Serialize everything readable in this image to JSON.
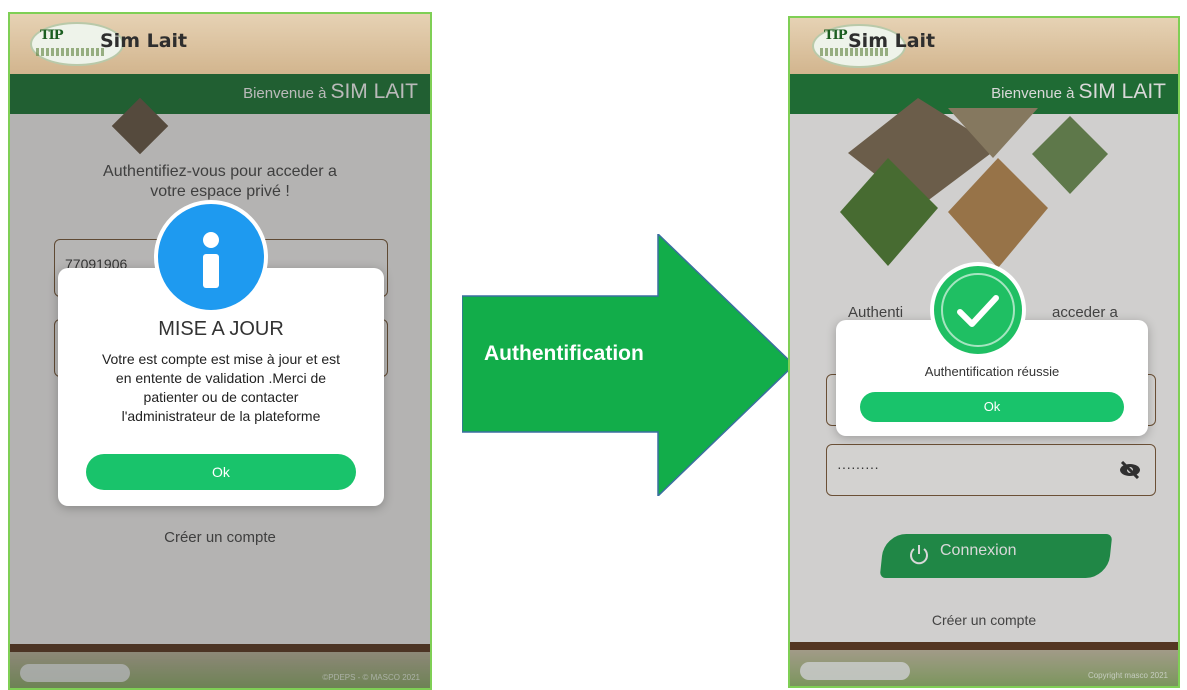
{
  "left_screen": {
    "app_name": "Sim Lait",
    "logo_text": "TIP",
    "welcome_prefix": "Bienvenue à",
    "welcome_brand": "SIM LAIT",
    "auth_prompt_line1": "Authentifiez-vous pour acceder a",
    "auth_prompt_line2": "votre espace privé !",
    "phone_field_value": "77091906",
    "dialog": {
      "title": "MISE A JOUR",
      "message_lines": [
        "Votre est compte est mise à jour et est",
        "en entente de validation .Merci de",
        "patienter ou de contacter",
        "l'administrateur de la plateforme"
      ],
      "ok_label": "Ok"
    },
    "create_account": "Créer un compte",
    "footer_copy": "©PDEPS - © MASCO 2021"
  },
  "arrow": {
    "label": "Authentification",
    "color": "#12ad4a"
  },
  "right_screen": {
    "app_name": "Sim Lait",
    "logo_text": "TIP",
    "welcome_prefix": "Bienvenue à",
    "welcome_brand": "SIM LAIT",
    "auth_prompt_partial_left": "Authenti",
    "auth_prompt_partial_right": "acceder a",
    "password_value": "·········",
    "dialog": {
      "message": "Authentification réussie",
      "ok_label": "Ok"
    },
    "connexion_label": "Connexion",
    "create_account": "Créer un compte",
    "footer_copy": "Copyright masco 2021"
  },
  "colors": {
    "header_green": "#1e7a37",
    "button_green": "#19c36b",
    "info_blue": "#1e9af0",
    "success_green": "#1fbf63"
  },
  "icons": {
    "info": "info-icon",
    "success": "checkmark-icon",
    "eye": "eye-slash-icon",
    "power": "power-icon"
  }
}
